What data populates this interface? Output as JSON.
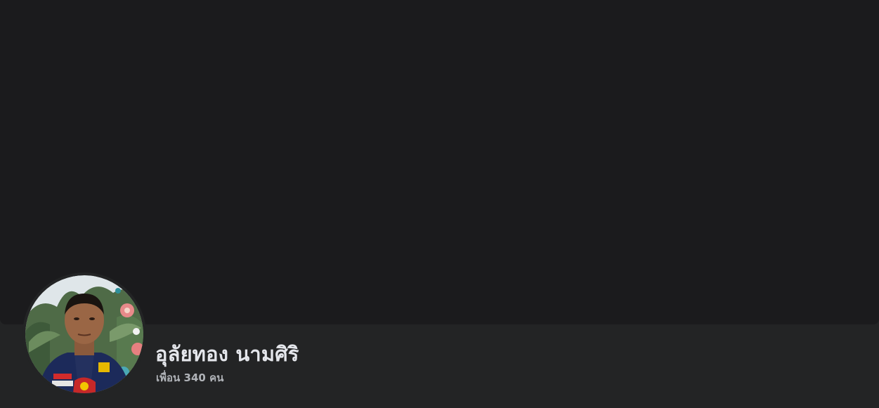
{
  "profile": {
    "name": "อุลัยทอง นามศิริ",
    "friends_label": "เพื่อน",
    "friends_count": "340",
    "friends_unit": "คน",
    "avatar_icon": "profile-photo-icon"
  },
  "colors": {
    "cover_bg": "#1b1b1d",
    "bar_bg": "#232425",
    "name_text": "#e4e6eb",
    "secondary_text": "#b0b3b8"
  }
}
